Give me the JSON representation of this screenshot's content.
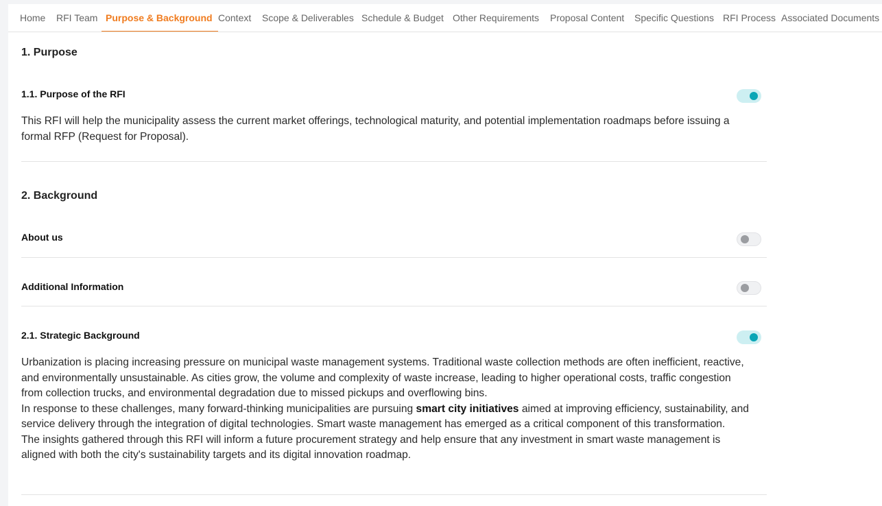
{
  "tabs": [
    {
      "label": "Home",
      "active": false
    },
    {
      "label": "RFI Team",
      "active": false
    },
    {
      "label": "Purpose & Background",
      "active": true
    },
    {
      "label": "Context",
      "active": false
    },
    {
      "label": "Scope & Deliverables",
      "active": false
    },
    {
      "label": "Schedule & Budget",
      "active": false
    },
    {
      "label": "Other Requirements",
      "active": false
    },
    {
      "label": "Proposal Content",
      "active": false
    },
    {
      "label": "Specific Questions",
      "active": false
    },
    {
      "label": "RFI Process",
      "active": false
    },
    {
      "label": "Associated Documents",
      "active": false
    }
  ],
  "purpose": {
    "heading": "1. Purpose",
    "subsection": {
      "title": "1.1. Purpose of the RFI",
      "enabled": true,
      "text": "This RFI will help the municipality assess the current market offerings, technological maturity, and potential implementation roadmaps before issuing a formal RFP (Request for Proposal)."
    }
  },
  "background": {
    "heading": "2. Background",
    "about_us": {
      "title": "About us",
      "enabled": false
    },
    "additional_info": {
      "title": "Additional Information",
      "enabled": false
    },
    "strategic": {
      "title": "2.1. Strategic Background",
      "enabled": true,
      "p1": "Urbanization is placing increasing pressure on municipal waste management systems. Traditional waste collection methods are often inefficient, reactive, and environmentally unsustainable. As cities grow, the volume and complexity of waste increase, leading to higher operational costs, traffic congestion from collection trucks, and environmental degradation due to missed pickups and overflowing bins.",
      "p2_before": "In response to these challenges, many forward-thinking municipalities are pursuing ",
      "p2_bold": "smart city initiatives",
      "p2_after": " aimed at improving efficiency, sustainability, and service delivery through the integration of digital technologies. Smart waste management has emerged as a critical component of this transformation.",
      "p3": "The insights gathered through this RFI will inform a future procurement strategy and help ensure that any investment in smart waste management is aligned with both the city's sustainability targets and its digital innovation roadmap."
    }
  }
}
